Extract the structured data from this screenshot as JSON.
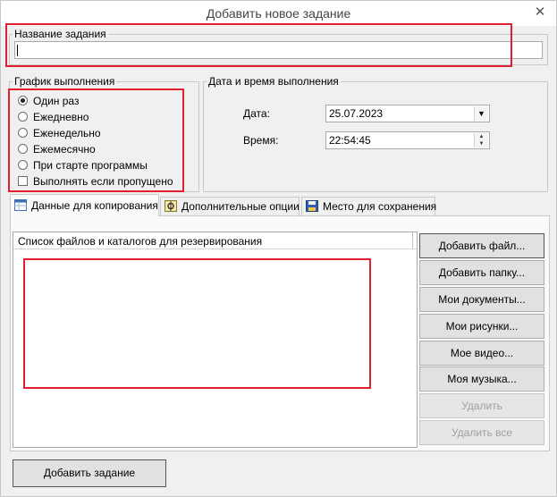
{
  "window": {
    "title": "Добавить новое задание",
    "close_glyph": "✕"
  },
  "task_name": {
    "label": "Название задания",
    "value": ""
  },
  "schedule": {
    "label": "График выполнения",
    "options": [
      "Один раз",
      "Ежедневно",
      "Еженедельно",
      "Ежемесячно",
      "При старте программы"
    ],
    "selected": "Один раз",
    "run_if_missed": {
      "label": "Выполнять если пропущено",
      "checked": false
    }
  },
  "datetime": {
    "label": "Дата и время выполнения",
    "date_label": "Дата:",
    "date_value": "25.07.2023",
    "time_label": "Время:",
    "time_value": "22:54:45"
  },
  "tabs": [
    {
      "label": "Данные для копирования",
      "active": true,
      "icon": "table-icon"
    },
    {
      "label": "Дополнительные опции",
      "active": false,
      "icon": "options-icon"
    },
    {
      "label": "Место для сохранения",
      "active": false,
      "icon": "floppy-disk-icon"
    }
  ],
  "file_list": {
    "header": "Список файлов и каталогов для резервирования",
    "items": []
  },
  "side_buttons": [
    {
      "label": "Добавить файл...",
      "enabled": true
    },
    {
      "label": "Добавить папку...",
      "enabled": true
    },
    {
      "label": "Мои документы...",
      "enabled": true
    },
    {
      "label": "Мои рисунки...",
      "enabled": true
    },
    {
      "label": "Мое видео...",
      "enabled": true
    },
    {
      "label": "Моя музыка...",
      "enabled": true
    },
    {
      "label": "Удалить",
      "enabled": false
    },
    {
      "label": "Удалить все",
      "enabled": false
    }
  ],
  "add_task_button": "Добавить задание",
  "colors": {
    "annotation": "#e0202f",
    "window_bg": "#f0f0f0"
  }
}
